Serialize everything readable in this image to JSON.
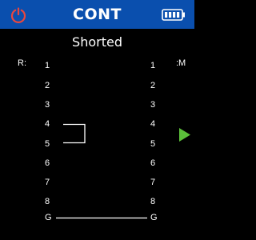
{
  "header": {
    "title": "CONT",
    "power_icon": "power-icon",
    "battery_icon": "battery-full-icon",
    "accent_color": "#0a4fae",
    "icon_color": "#e8473f"
  },
  "status": {
    "text": "Shorted"
  },
  "labels": {
    "left": "R:",
    "right": ":M"
  },
  "pins": {
    "left": [
      "1",
      "2",
      "3",
      "4",
      "5",
      "6",
      "7",
      "8",
      "G"
    ],
    "right": [
      "1",
      "2",
      "3",
      "4",
      "5",
      "6",
      "7",
      "8",
      "G"
    ]
  },
  "connections": [
    {
      "type": "short",
      "side": "left",
      "from": "4",
      "to": "5"
    },
    {
      "type": "straight",
      "from": "G",
      "to": "G"
    }
  ],
  "indicator": {
    "icon": "play-icon",
    "color": "#5bbf3a"
  }
}
